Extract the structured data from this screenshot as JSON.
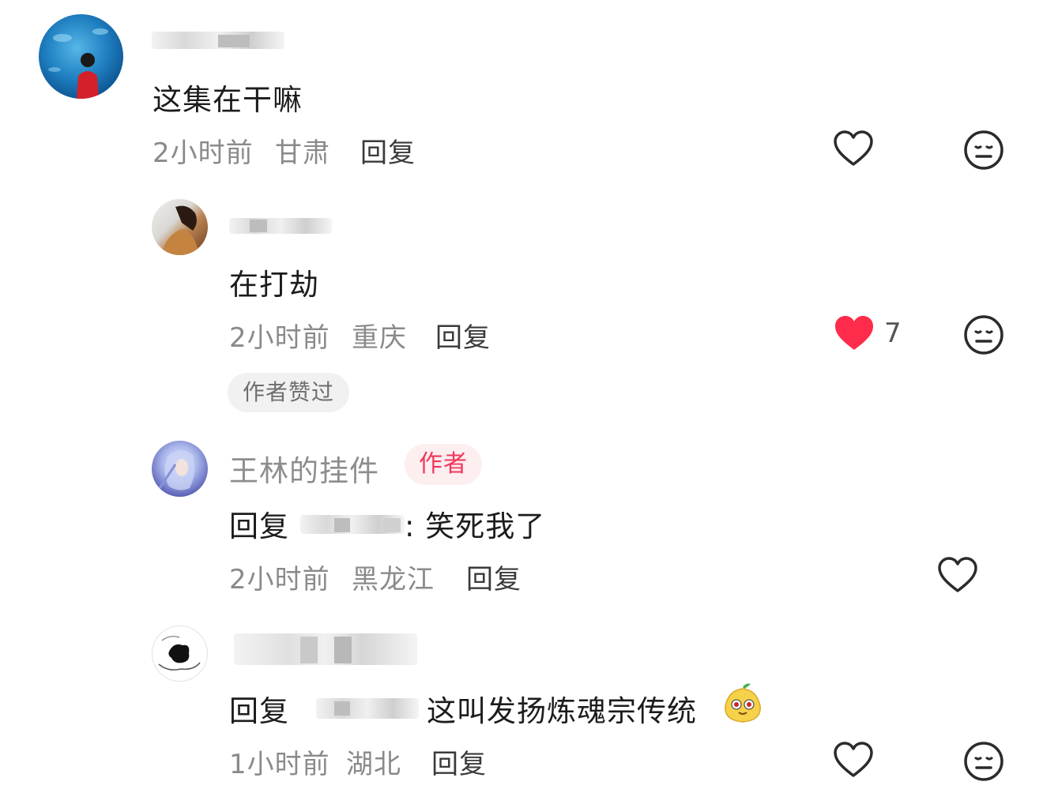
{
  "comments": [
    {
      "text": "这集在干嘛",
      "time": "2小时前",
      "location": "甘肃",
      "reply_label": "回复"
    },
    {
      "text": "在打劫",
      "time": "2小时前",
      "location": "重庆",
      "reply_label": "回复",
      "likes": "7",
      "liked": true,
      "author_liked_label": "作者赞过"
    },
    {
      "username": "王林的挂件",
      "author_badge": "作者",
      "reply_prefix": "回复",
      "text": ": 笑死我了",
      "time": "2小时前",
      "location": "黑龙江",
      "reply_label": "回复"
    },
    {
      "reply_prefix": "回复",
      "text": "这叫发扬炼魂宗传统",
      "time": "1小时前",
      "location": "湖北",
      "reply_label": "回复"
    }
  ],
  "colors": {
    "liked_heart": "#ff2b4a",
    "author_badge_text": "#f0375a",
    "author_badge_bg": "#fdeef0"
  },
  "icons": {
    "like": "heart-outline-icon",
    "liked": "heart-filled-icon",
    "dislike": "meh-face-icon",
    "emoji": "pear-mascot-emoji"
  }
}
